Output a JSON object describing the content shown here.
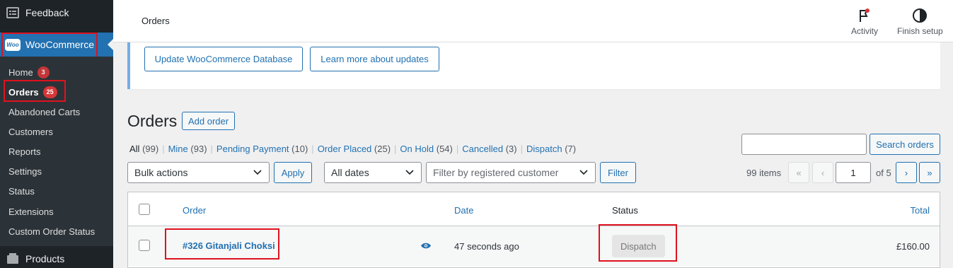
{
  "sidebar": {
    "feedback_label": "Feedback",
    "woocommerce_label": "WooCommerce",
    "woo_logo_text": "Woo",
    "products_label": "Products",
    "submenu": [
      {
        "label": "Home",
        "count": "3"
      },
      {
        "label": "Orders",
        "count": "25"
      },
      {
        "label": "Abandoned Carts"
      },
      {
        "label": "Customers"
      },
      {
        "label": "Reports"
      },
      {
        "label": "Settings"
      },
      {
        "label": "Status"
      },
      {
        "label": "Extensions"
      },
      {
        "label": "Custom Order Status"
      }
    ]
  },
  "topbar": {
    "title": "Orders",
    "activity_label": "Activity",
    "finish_setup_label": "Finish setup"
  },
  "notice": {
    "update_db_label": "Update WooCommerce Database",
    "learn_more_label": "Learn more about updates"
  },
  "page": {
    "heading": "Orders",
    "add_order_label": "Add order"
  },
  "filters": {
    "views": [
      {
        "label": "All",
        "count": "(99)"
      },
      {
        "label": "Mine",
        "count": "(93)"
      },
      {
        "label": "Pending Payment",
        "count": "(10)"
      },
      {
        "label": "Order Placed",
        "count": "(25)"
      },
      {
        "label": "On Hold",
        "count": "(54)"
      },
      {
        "label": "Cancelled",
        "count": "(3)"
      },
      {
        "label": "Dispatch",
        "count": "(7)"
      }
    ],
    "view_separator": "|",
    "search_value": "",
    "search_button_label": "Search orders",
    "bulk_actions_value": "Bulk actions",
    "apply_label": "Apply",
    "dates_value": "All dates",
    "customer_placeholder": "Filter by registered customer",
    "filter_label": "Filter"
  },
  "pagination": {
    "items_label": "99 items",
    "first": "«",
    "prev": "‹",
    "current_page": "1",
    "of_label": "of 5",
    "next": "›",
    "last": "»"
  },
  "table": {
    "headers": {
      "order": "Order",
      "date": "Date",
      "status": "Status",
      "total": "Total"
    },
    "rows": [
      {
        "order": "#326 Gitanjali Choksi",
        "date": "47 seconds ago",
        "status": "Dispatch",
        "total": "£160.00"
      }
    ]
  },
  "colors": {
    "accent": "#2271b1",
    "sidebar_bg": "#1d2327",
    "badge_red": "#d63638",
    "highlight_box": "#e0121f"
  }
}
